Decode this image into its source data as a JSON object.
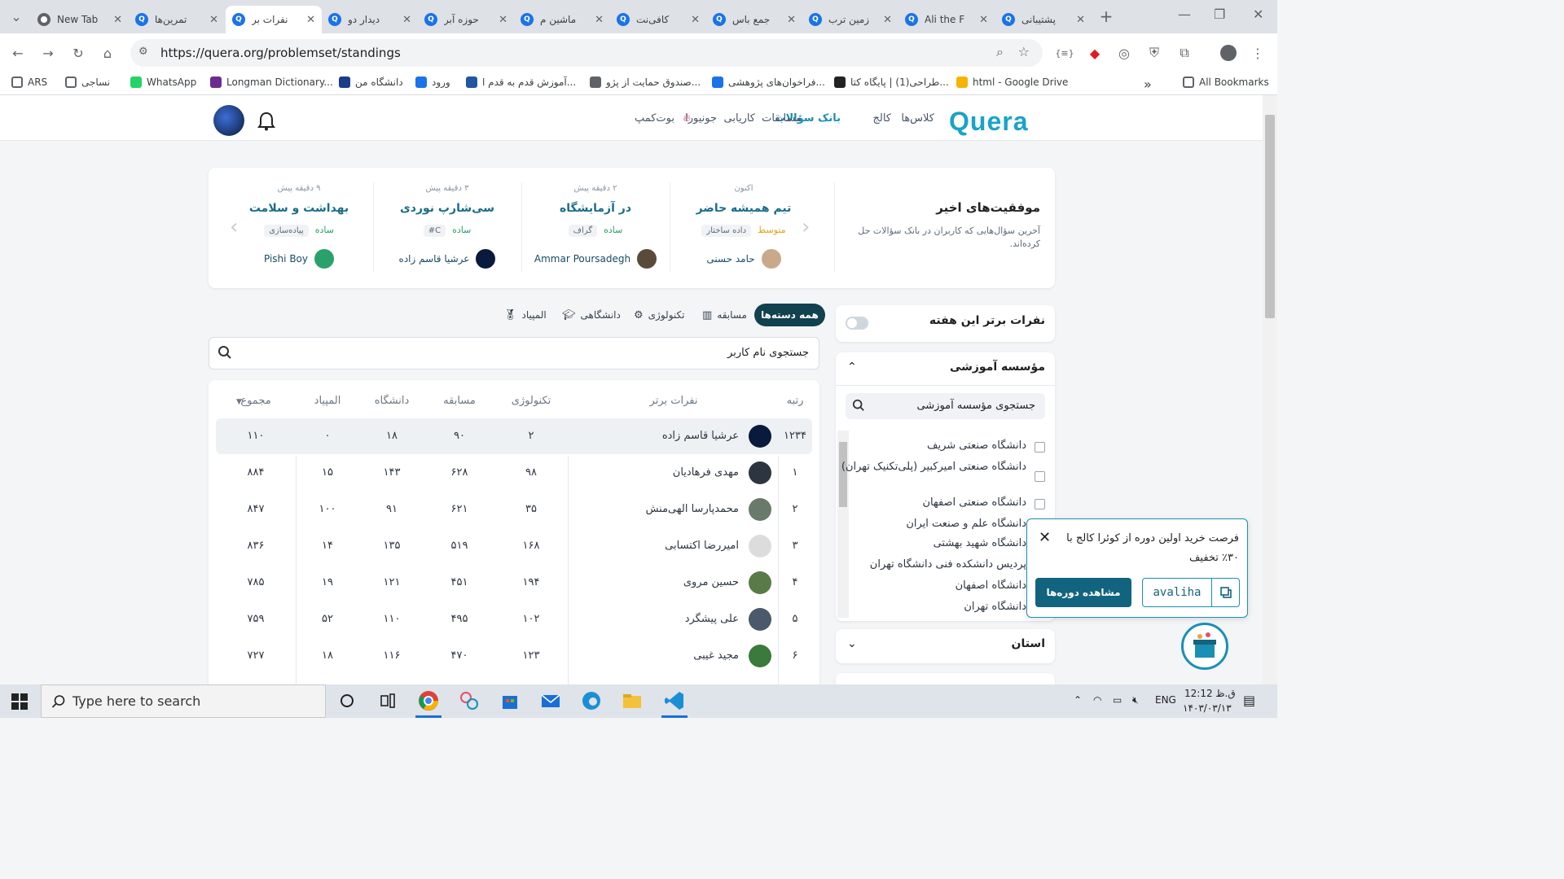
{
  "browser": {
    "tabs": [
      {
        "title": "New Tab",
        "icon": "chrome-icon",
        "active": false
      },
      {
        "title": "تمرین‌ها",
        "icon": "quera-icon",
        "active": false
      },
      {
        "title": "نفرات بر",
        "icon": "quera-icon",
        "active": true
      },
      {
        "title": "دیدار دو",
        "icon": "quera-icon",
        "active": false
      },
      {
        "title": "حوزه آبر",
        "icon": "quera-icon",
        "active": false
      },
      {
        "title": "ماشین م",
        "icon": "quera-icon",
        "active": false
      },
      {
        "title": "کافی‌نت",
        "icon": "quera-icon",
        "active": false
      },
      {
        "title": "جمع باس",
        "icon": "quera-icon",
        "active": false
      },
      {
        "title": "زمین ترب",
        "icon": "quera-icon",
        "active": false
      },
      {
        "title": "Ali the F",
        "icon": "quera-icon",
        "active": false
      },
      {
        "title": "پشتیبانی",
        "icon": "quera-icon",
        "active": false
      }
    ],
    "url": "https://quera.org/problemset/standings",
    "bookmarks": [
      {
        "label": "ARS",
        "icon": "folder-icon"
      },
      {
        "label": "نساجی",
        "icon": "folder-icon"
      },
      {
        "label": "WhatsApp",
        "icon": "whatsapp-icon"
      },
      {
        "label": "Longman Dictionary...",
        "icon": "longman-icon"
      },
      {
        "label": "دانشگاه من",
        "icon": "university-icon"
      },
      {
        "label": "ورود",
        "icon": "login-icon"
      },
      {
        "label": "آموزش قدم به قدم ا...",
        "icon": "tutorial-icon"
      },
      {
        "label": "صندوق حمایت از پژو...",
        "icon": "fund-icon"
      },
      {
        "label": "فراخوان‌های پژوهشی...",
        "icon": "research-icon"
      },
      {
        "label": "طراحی(1) | پایگاه کتا...",
        "icon": "book-icon"
      },
      {
        "label": "html - Google Drive",
        "icon": "drive-icon"
      }
    ],
    "all_bookmarks": "All Bookmarks"
  },
  "site": {
    "logo": "Quera",
    "nav": [
      "کلاس‌ها",
      "کالج",
      "بانک سؤالات",
      "مسابقات",
      "کاریابی",
      "جونیورا",
      "بوت‌کمپ"
    ],
    "nav_active": "بانک سؤالات"
  },
  "achievements": {
    "title": "موفقیت‌های اخیر",
    "subtitle": "آخرین سؤال‌هایی که کاربران در بانک سؤالات حل کرده‌اند.",
    "items": [
      {
        "time": "اکنون",
        "name": "تیم همیشه حاضر",
        "level": "متوسط",
        "tag": "داده ساختار",
        "user": "حامد حسنی"
      },
      {
        "time": "۲ دقیقه پیش",
        "name": "در آزمایشگاه",
        "level": "ساده",
        "tag": "گراف",
        "user": "Ammar Poursadegh"
      },
      {
        "time": "۳ دقیقه پیش",
        "name": "سی‌شارپ نوردی",
        "level": "ساده",
        "tag": "C#",
        "user": "عرشیا قاسم زاده"
      },
      {
        "time": "۹ دقیقه پیش",
        "name": "بهداشت و سلامت",
        "level": "ساده",
        "tag": "پیاده‌سازی",
        "user": "Pishi Boy"
      }
    ]
  },
  "filters": {
    "items": [
      "همه دسته‌ها",
      "مسابقه",
      "تکنولوژی",
      "دانشگاهی",
      "المپیاد"
    ],
    "active": "همه دسته‌ها"
  },
  "search": {
    "placeholder": "جستجوی نام کاربر"
  },
  "table": {
    "headers": {
      "rank": "رتبه",
      "name": "نفرات برتر",
      "tech": "تکنولوژی",
      "contest": "مسابقه",
      "uni": "دانشگاه",
      "olympiad": "المپیاد",
      "total": "مجموع"
    },
    "rows": [
      {
        "rank": "۱۲۳۴",
        "name": "عرشیا قاسم زاده",
        "tech": "۲",
        "contest": "۹۰",
        "uni": "۱۸",
        "olympiad": "۰",
        "total": "۱۱۰",
        "me": true
      },
      {
        "rank": "۱",
        "name": "مهدی فرهادیان",
        "tech": "۹۸",
        "contest": "۶۲۸",
        "uni": "۱۴۳",
        "olympiad": "۱۵",
        "total": "۸۸۴"
      },
      {
        "rank": "۲",
        "name": "محمدپارسا الهی‌منش",
        "tech": "۳۵",
        "contest": "۶۲۱",
        "uni": "۹۱",
        "olympiad": "۱۰۰",
        "total": "۸۴۷"
      },
      {
        "rank": "۳",
        "name": "امیررضا اکتسابی",
        "tech": "۱۶۸",
        "contest": "۵۱۹",
        "uni": "۱۳۵",
        "olympiad": "۱۴",
        "total": "۸۳۶"
      },
      {
        "rank": "۴",
        "name": "حسین مروی",
        "tech": "۱۹۴",
        "contest": "۴۵۱",
        "uni": "۱۲۱",
        "olympiad": "۱۹",
        "total": "۷۸۵"
      },
      {
        "rank": "۵",
        "name": "علی پیشگرد",
        "tech": "۱۰۲",
        "contest": "۴۹۵",
        "uni": "۱۱۰",
        "olympiad": "۵۲",
        "total": "۷۵۹"
      },
      {
        "rank": "۶",
        "name": "مجید غیبی",
        "tech": "۱۲۳",
        "contest": "۴۷۰",
        "uni": "۱۱۶",
        "olympiad": "۱۸",
        "total": "۷۲۷"
      }
    ]
  },
  "sidebar": {
    "week_toggle_label": "نفرات برتر این هفته",
    "institute_title": "مؤسسه آموزشی",
    "institute_search": "جستجوی مؤسسه آموزشی",
    "institutes": [
      "دانشگاه صنعتی شریف",
      "دانشگاه صنعتی امیرکبیر (پلی‌تکنیک تهران)",
      "دانشگاه صنعتی اصفهان",
      "دانشگاه علم و صنعت ایران",
      "دانشگاه شهید بهشتی",
      "پردیس دانشکده فنی دانشگاه تهران",
      "دانشگاه اصفهان",
      "دانشگاه تهران"
    ],
    "province_title": "استان"
  },
  "popup": {
    "message": "فرصت خرید اولین دوره از کوئرا کالج با ۳۰٪ تخفیف",
    "button": "مشاهده دوره‌ها",
    "code": "avaliha"
  },
  "taskbar": {
    "search_placeholder": "Type here to search",
    "lang": "ENG",
    "time": "ق.ظ 12:12",
    "date": "۱۴۰۳/۰۳/۱۳"
  }
}
